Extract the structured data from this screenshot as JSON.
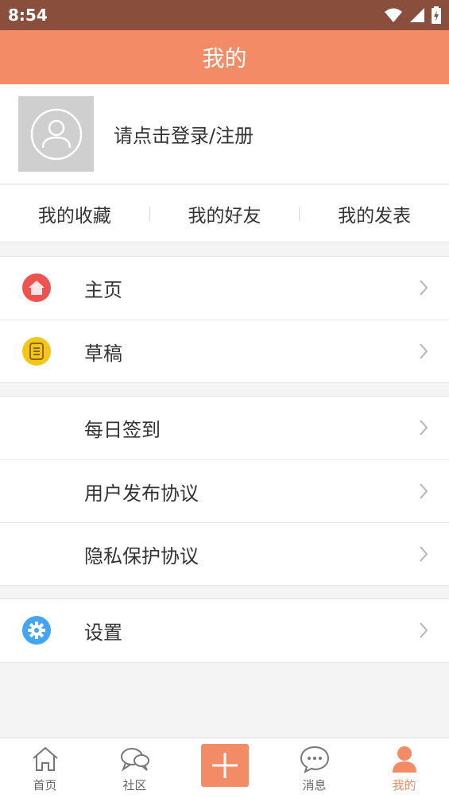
{
  "status_bar": {
    "time": "8:54"
  },
  "header": {
    "title": "我的"
  },
  "profile": {
    "login_text": "请点击登录/注册"
  },
  "quick_links": [
    {
      "label": "我的收藏"
    },
    {
      "label": "我的好友"
    },
    {
      "label": "我的发表"
    }
  ],
  "menu_groups": [
    {
      "items": [
        {
          "label": "主页",
          "icon": "home-icon"
        },
        {
          "label": "草稿",
          "icon": "draft-icon"
        }
      ]
    },
    {
      "items": [
        {
          "label": "每日签到"
        },
        {
          "label": "用户发布协议"
        },
        {
          "label": "隐私保护协议"
        }
      ]
    },
    {
      "items": [
        {
          "label": "设置",
          "icon": "settings-icon"
        }
      ]
    }
  ],
  "tabbar": {
    "items": [
      {
        "label": "首页",
        "icon": "home-outline-icon"
      },
      {
        "label": "社区",
        "icon": "community-icon"
      },
      {
        "label": "",
        "icon": "plus-icon"
      },
      {
        "label": "消息",
        "icon": "message-icon"
      },
      {
        "label": "我的",
        "icon": "person-icon",
        "active": true
      }
    ]
  },
  "colors": {
    "accent": "#f28b66",
    "status_bar": "#8a4e3c"
  }
}
